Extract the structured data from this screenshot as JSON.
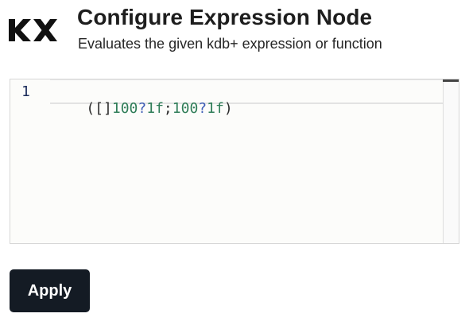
{
  "header": {
    "title": "Configure Expression Node",
    "subtitle": "Evaluates the given kdb+ expression or function"
  },
  "logo": {
    "icon": "kx-logo-icon",
    "text": "KX"
  },
  "editor": {
    "line_numbers": [
      "1"
    ],
    "code_tokens": [
      {
        "text": "([]",
        "kind": "paren"
      },
      {
        "text": "100",
        "kind": "num"
      },
      {
        "text": "?",
        "kind": "op"
      },
      {
        "text": "1f",
        "kind": "num"
      },
      {
        "text": ";",
        "kind": "paren"
      },
      {
        "text": "100",
        "kind": "num"
      },
      {
        "text": "?",
        "kind": "op"
      },
      {
        "text": "1f",
        "kind": "num"
      },
      {
        "text": ")",
        "kind": "paren"
      }
    ]
  },
  "actions": {
    "apply_label": "Apply"
  },
  "colors": {
    "number_token": "#2f7d58",
    "operator_token": "#3b5bb5",
    "button_bg": "#141b24"
  }
}
